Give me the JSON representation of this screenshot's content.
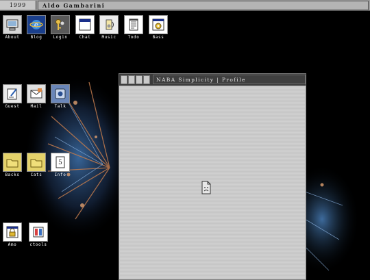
{
  "topbar": {
    "year": "1999",
    "owner_name": "Aldo Gambarini"
  },
  "desktop_icons": [
    {
      "label": "About",
      "icon": "computer-icon"
    },
    {
      "label": "Blog",
      "icon": "internet-explorer-icon"
    },
    {
      "label": "Login",
      "icon": "keys-icon"
    },
    {
      "label": "Chat",
      "icon": "window-icon"
    },
    {
      "label": "Music",
      "icon": "speaker-icon"
    },
    {
      "label": "Todo",
      "icon": "notepad-icon"
    },
    {
      "label": "Bass",
      "icon": "gear-icon"
    },
    {
      "label": "Guest",
      "icon": "guestbook-icon"
    },
    {
      "label": "Mail",
      "icon": "mail-icon"
    },
    {
      "label": "Talk",
      "icon": "talk-icon"
    },
    {
      "label": "Backs",
      "icon": "folder-icon"
    },
    {
      "label": "Cats",
      "icon": "folder-icon"
    },
    {
      "label": "Info",
      "icon": "info-document-icon"
    },
    {
      "label": "Amo",
      "icon": "lock-icon"
    },
    {
      "label": "ctools",
      "icon": "tools-icon"
    }
  ],
  "window": {
    "title": "NABA Simplicity | Profile",
    "content_icon": "broken-image-icon"
  }
}
